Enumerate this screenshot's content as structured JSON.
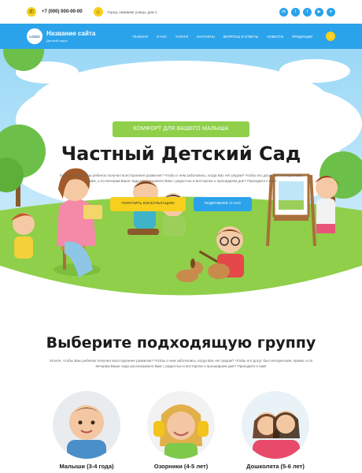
{
  "topbar": {
    "phone": "+7 (000) 000-00-00",
    "address": "Город, название улицы, дом 1",
    "socials": [
      "vk",
      "twitter",
      "facebook",
      "youtube",
      "telegram"
    ]
  },
  "nav": {
    "logo": "LOGO",
    "site_title": "Название сайта",
    "site_subtitle": "Детский садик",
    "items": [
      "Главная",
      "О нас",
      "Услуги",
      "Контакты",
      "Вопросы и ответы",
      "Новости",
      "Продукции"
    ]
  },
  "hero": {
    "badge": "КОМФОРТ ДЛЯ ВАШЕГО МАЛЫША",
    "title": "Частный Детский Сад",
    "text": "Хотите, чтобы Ваш ребенок получил всестороннее развитие? Чтобы о нем заботились, когда Вас нет рядом? Чтобы его досуг был интересным, ярким, а по вечерам Ваше чадо рассказывало Вам с радостью и восторгом о прошедшем дне? Приходите к нам!",
    "btn_consult": "Получить консультацию",
    "btn_more": "Подробнее о нас"
  },
  "groups": {
    "title": "Выберите подходящую группу",
    "text": "Хотите, чтобы Ваш ребенок получил всестороннее развитие? Чтобы о нем заботились, когда Вас нет рядом? Чтобы его досуг был интересным, ярким, а по вечерам Ваше чадо рассказывало Вам с радостью и восторгом о прошедшем дне? Приходите к нам!",
    "items": [
      {
        "label": "Малыши (3-4 года)"
      },
      {
        "label": "Озорники (4-5 лет)"
      },
      {
        "label": "Дошколята (5-6 лет)"
      }
    ]
  },
  "colors": {
    "primary": "#2aa3ea",
    "accent": "#f7cf1c",
    "green": "#8fcf4a"
  }
}
